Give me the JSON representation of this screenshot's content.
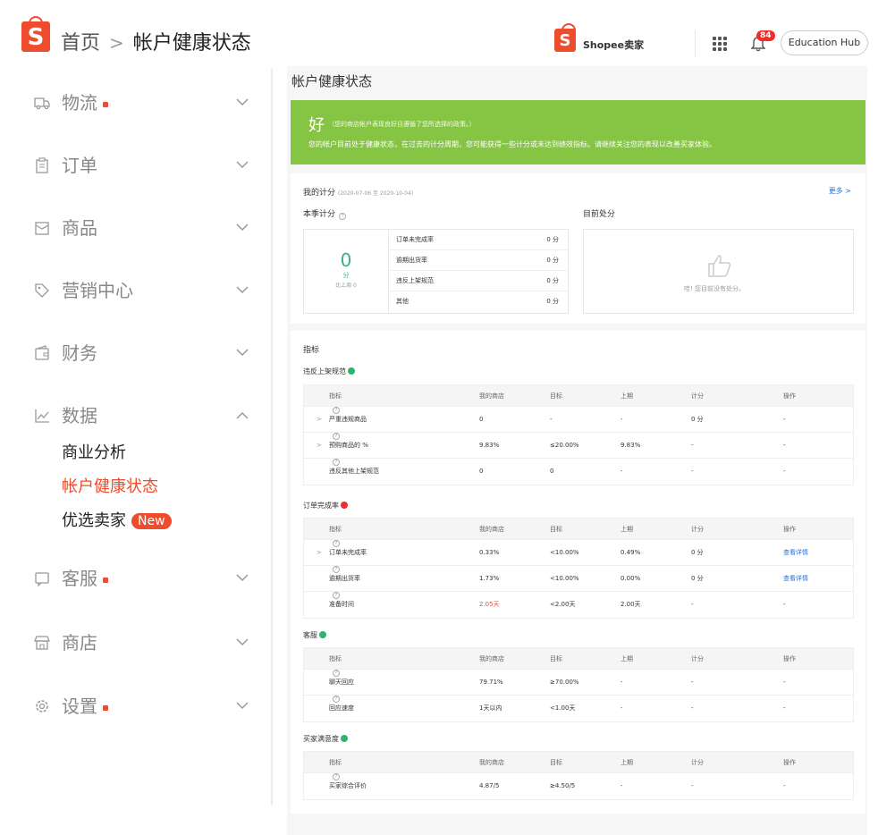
{
  "header": {
    "breadcrumb_home": "首页",
    "breadcrumb_sep": ">",
    "breadcrumb_current": "帐户健康状态",
    "seller_brand": "Shopee卖家",
    "notification_count": "84",
    "education_hub": "Education Hub",
    "brand_color": "#ee4d2d"
  },
  "sidebar": {
    "menus": [
      {
        "label": "物流",
        "icon": "truck-icon",
        "dot": true
      },
      {
        "label": "订单",
        "icon": "clipboard-icon",
        "dot": false
      },
      {
        "label": "商品",
        "icon": "box-icon",
        "dot": false
      },
      {
        "label": "营销中心",
        "icon": "tag-icon",
        "dot": false
      },
      {
        "label": "财务",
        "icon": "wallet-icon",
        "dot": false
      },
      {
        "label": "数据",
        "icon": "chart-icon",
        "dot": false,
        "expanded": true
      },
      {
        "label": "客服",
        "icon": "chat-icon",
        "dot": true
      },
      {
        "label": "商店",
        "icon": "store-icon",
        "dot": false
      },
      {
        "label": "设置",
        "icon": "gear-icon",
        "dot": true
      }
    ],
    "data_sub": [
      "商业分析",
      "帐户健康状态",
      "优选卖家"
    ],
    "new_badge": "New"
  },
  "main": {
    "title": "帐户健康状态",
    "banner": {
      "status": "好",
      "status_note": "（您的商店帐户表现良好且遵循了您所选择的政策。）",
      "description": "您的帐户目前处于健康状态，在过去的计分周期，您可能获得一些计分或未达到绩效指标。请继续关注您的表现以改善买家体验。"
    },
    "score": {
      "title": "我的计分",
      "period": "(2020-07-06 至 2020-10-04)",
      "more": "更多 >",
      "quarter_label": "本季计分",
      "current_penalty_label": "目前处分",
      "total": "0",
      "unit": "分",
      "compare": "比上周 0",
      "rows": [
        {
          "k": "订单未完成率",
          "v": "0 分"
        },
        {
          "k": "逾期出货率",
          "v": "0 分"
        },
        {
          "k": "违反上架规范",
          "v": "0 分"
        },
        {
          "k": "其他",
          "v": "0 分"
        }
      ],
      "no_penalty": "哇! 您目前没有处分。"
    },
    "metrics": {
      "title": "指标",
      "headers": [
        "指标",
        "我的商店",
        "目标",
        "上期",
        "计分",
        "操作"
      ],
      "sections": [
        {
          "name": "违反上架规范",
          "status": "good",
          "rows": [
            {
              "expand": ">",
              "name": "严重违规商品",
              "mine": "0",
              "target": "-",
              "last": "-",
              "score": "0 分",
              "action": "-"
            },
            {
              "expand": ">",
              "name": "预购商品的 %",
              "mine": "9.83%",
              "target": "≤20.00%",
              "last": "9.83%",
              "score": "-",
              "action": "-"
            },
            {
              "expand": "",
              "name": "违反其他上架规范",
              "mine": "0",
              "target": "0",
              "last": "-",
              "score": "-",
              "action": "-"
            }
          ]
        },
        {
          "name": "订单完成率",
          "status": "bad",
          "rows": [
            {
              "expand": ">",
              "name": "订单未完成率",
              "mine": "0.33%",
              "target": "<10.00%",
              "last": "0.49%",
              "score": "0 分",
              "action": "查看详情"
            },
            {
              "expand": "",
              "name": "逾期出货率",
              "mine": "1.73%",
              "target": "<10.00%",
              "last": "0.00%",
              "score": "0 分",
              "action": "查看详情"
            },
            {
              "expand": "",
              "name": "准备时间",
              "mine": "2.05天",
              "target": "<2.00天",
              "last": "2.00天",
              "score": "-",
              "action": "-"
            }
          ]
        },
        {
          "name": "客服",
          "status": "good",
          "rows": [
            {
              "expand": "",
              "name": "聊天回应",
              "mine": "79.71%",
              "target": "≥70.00%",
              "last": "-",
              "score": "-",
              "action": "-"
            },
            {
              "expand": "",
              "name": "回应速度",
              "mine": "1天以内",
              "target": "<1.00天",
              "last": "-",
              "score": "-",
              "action": "-"
            }
          ]
        },
        {
          "name": "买家满意度",
          "status": "good",
          "rows": [
            {
              "expand": "",
              "name": "买家综合评价",
              "mine": "4.87/5",
              "target": "≥4.50/5",
              "last": "-",
              "score": "-",
              "action": "-"
            }
          ]
        }
      ]
    }
  }
}
